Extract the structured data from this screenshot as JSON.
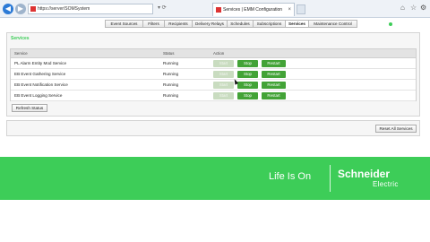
{
  "browser": {
    "back_label": "◀",
    "forward_label": "▶",
    "address": "https://server/SOMSystem",
    "address_controls": "▾ ⟳",
    "tab_title": "Services | EMM Configuration",
    "tab_close": "×",
    "window_icons": [
      "⌂",
      "☆",
      "⚙"
    ]
  },
  "app_tabs": [
    {
      "label": "Event Sources",
      "active": false
    },
    {
      "label": "Filters",
      "active": false
    },
    {
      "label": "Recipients",
      "active": false
    },
    {
      "label": "Delivery Relays",
      "active": false
    },
    {
      "label": "Schedules",
      "active": false
    },
    {
      "label": "Subscriptions",
      "active": false
    },
    {
      "label": "Services",
      "active": true
    },
    {
      "label": "Maintenance Control",
      "active": false
    }
  ],
  "services_panel": {
    "title": "Services",
    "columns": {
      "service": "Service",
      "status": "Status",
      "action": "Action"
    },
    "rows": [
      {
        "service": "PL Alarm Entity Mod Service",
        "status": "Running"
      },
      {
        "service": "EB Event Gathering Service",
        "status": "Running"
      },
      {
        "service": "EB Event Notification Service",
        "status": "Running"
      },
      {
        "service": "EB Event Logging Service",
        "status": "Running"
      }
    ],
    "start_label": "Start",
    "stop_label": "Stop",
    "restart_label": "Restart",
    "refresh_label": "Refresh Status"
  },
  "reset_panel": {
    "reset_all_label": "Reset All Services"
  },
  "footer": {
    "tagline": "Life Is On",
    "brand_line1": "Schneider",
    "brand_line2": "Electric"
  },
  "colors": {
    "accent": "#3dcd58",
    "button_green": "#43a337"
  }
}
